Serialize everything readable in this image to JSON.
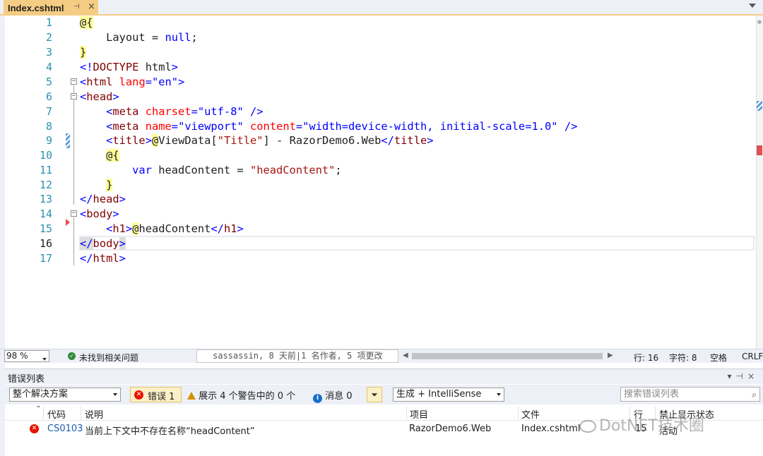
{
  "tab": {
    "title": "Index.cshtml",
    "pin_glyph": "⊣",
    "close_glyph": "×"
  },
  "editor": {
    "line_numbers": [
      "1",
      "2",
      "3",
      "4",
      "5",
      "6",
      "7",
      "8",
      "9",
      "10",
      "11",
      "12",
      "13",
      "14",
      "15",
      "16",
      "17"
    ],
    "current_line": 16
  },
  "status": {
    "zoom": "98 %",
    "issues": "未找到相关问题",
    "codelens": "sassassin, 8 天前|1 名作者, 5 项更改",
    "line": "行: 16",
    "char": "字符: 8",
    "space": "空格",
    "eol": "CRLF"
  },
  "error_list": {
    "title": "错误列表",
    "scope": "整个解决方案",
    "errors_btn": "错误 1",
    "warnings_btn": "展示 4 个警告中的 0 个",
    "messages_btn": "消息 0",
    "build_filter": "生成 + IntelliSense",
    "search_placeholder": "搜索错误列表",
    "columns": {
      "code": "代码",
      "desc": "说明",
      "project": "项目",
      "file": "文件",
      "line": "行",
      "suppress": "禁止显示状态"
    },
    "rows": [
      {
        "code": "CS0103",
        "desc": "当前上下文中不存在名称“headContent”",
        "project": "RazorDemo6.Web",
        "file": "Index.cshtml",
        "line": "15",
        "suppress": "活动"
      }
    ]
  },
  "watermark": "DotNET技术圈",
  "colors": {
    "tab_active": "#f5cc84",
    "error": "#e51400",
    "warning": "#d49000",
    "info": "#1a6fc9",
    "line_number": "#2b91af",
    "keyword": "#0000ff",
    "tag": "#800000",
    "attribute": "#ff0000",
    "string": "#a31515"
  }
}
